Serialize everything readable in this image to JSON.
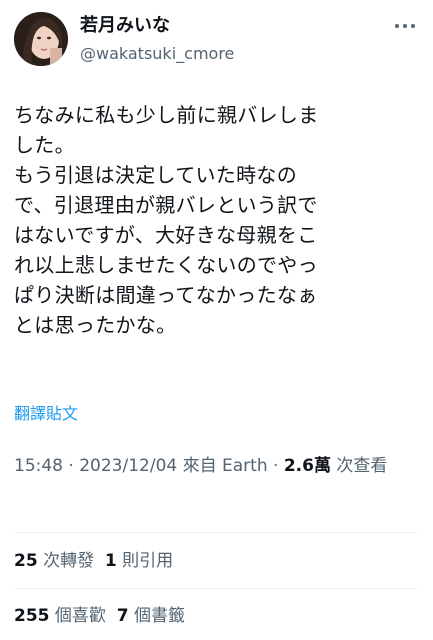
{
  "author": {
    "display_name": "若月みいな",
    "handle": "@wakatsuki_cmore"
  },
  "more_icon": "more-horizontal-icon",
  "tweet": {
    "text": "ちなみに私も少し前に親バレしま\nした。\nもう引退は決定していた時なの\nで、引退理由が親バレという訳で\nはないですが、大好きな母親をこ\nれ以上悲しませたくないのでやっ\nぱり決断は間違ってなかったなぁ\nとは思ったかな。"
  },
  "translate_label": "翻譯貼文",
  "meta": {
    "time": "15:48",
    "sep1": " · ",
    "date": "2023/12/04",
    "source": " 來自 Earth",
    "sep2": " · ",
    "views_count": "2.6萬",
    "views_label": " 次查看"
  },
  "stats": {
    "retweets_count": "25",
    "retweets_label": " 次轉發",
    "quotes_count": "1",
    "quotes_label": " 則引用",
    "likes_count": "255",
    "likes_label": " 個喜歡",
    "bookmarks_count": "7",
    "bookmarks_label": " 個書籤"
  },
  "colors": {
    "text": "#0f1419",
    "secondary": "#536471",
    "link": "#1d9bf0",
    "divider": "#eff3f4"
  }
}
